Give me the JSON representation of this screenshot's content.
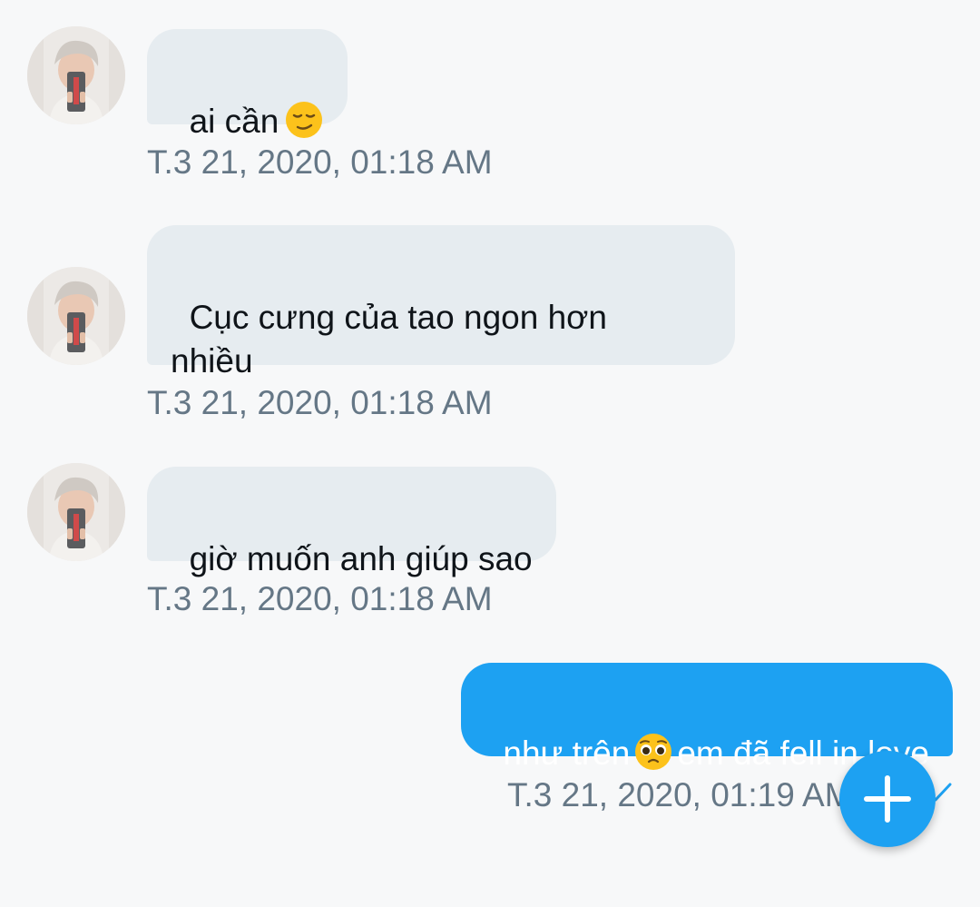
{
  "messages": [
    {
      "direction": "incoming",
      "text": "ai cần",
      "emoji": "relieved-face-icon",
      "time": "T.3 21, 2020, 01:18 AM"
    },
    {
      "direction": "incoming",
      "text": "Cục cưng của tao ngon hơn\nnhiều",
      "time": "T.3 21, 2020, 01:18 AM"
    },
    {
      "direction": "incoming",
      "text": "giờ muốn anh giúp sao",
      "time": "T.3 21, 2020, 01:18 AM"
    },
    {
      "direction": "outgoing",
      "text_before": "như trên",
      "emoji": "pleading-face-icon",
      "text_after": "em đã fell in love",
      "time": "T.3 21, 2020, 01:19 AM"
    }
  ],
  "fab": {
    "icon": "plus-icon"
  },
  "colors": {
    "background": "#f7f8f9",
    "incoming_bubble": "#e6ecf0",
    "outgoing_bubble": "#1da1f2",
    "timestamp": "#657786",
    "accent": "#1da1f2"
  }
}
